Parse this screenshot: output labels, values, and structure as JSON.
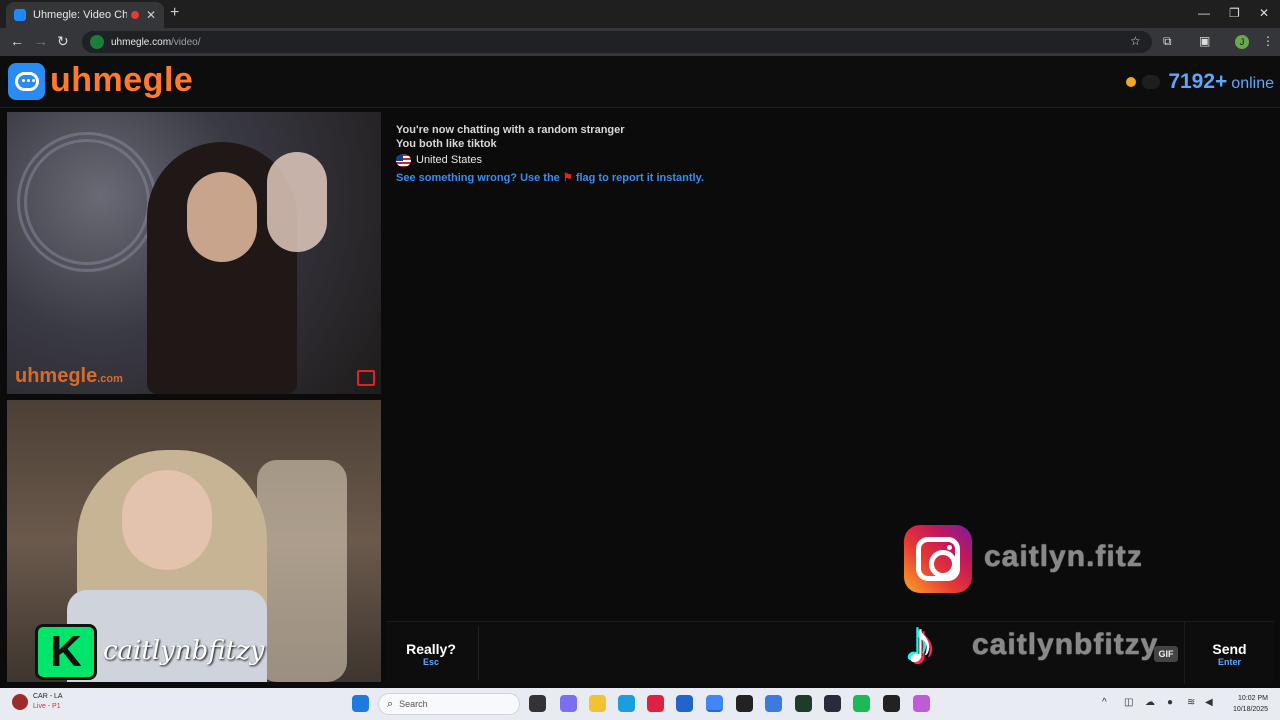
{
  "browser": {
    "tab_title": "Uhmegle: Video Chat | Ran",
    "new_tab": "+",
    "url_host": "uhmegle.com",
    "url_path": "/video/",
    "profile_initial": "J"
  },
  "header": {
    "logo_text": "uhmegle",
    "online_count": "7192+",
    "online_label": "online"
  },
  "stranger_video": {
    "watermark": "uhmegle",
    "watermark_suffix": ".com"
  },
  "self_video": {
    "badge_letter": "K",
    "streamer_name": "caitlynbfitzy"
  },
  "chat": {
    "lines": [
      "You're now chatting with a random stranger",
      "You both like tiktok"
    ],
    "country": "United States",
    "report_before": "See something wrong? Use the",
    "report_flag": "⚑",
    "report_after": "flag to report it instantly."
  },
  "overlays": {
    "instagram_handle": "caitlyn.fitz",
    "tiktok_handle": "caitlynbfitzy",
    "tiktok_glyph": "♪"
  },
  "controls": {
    "skip_label": "Really?",
    "skip_key": "Esc",
    "gif_label": "GIF",
    "send_label": "Send",
    "send_key": "Enter",
    "message_value": ""
  },
  "taskbar": {
    "weather_title": "CAR - LA",
    "weather_status": "Live - P1",
    "search_placeholder": "Search",
    "time": "10:02 PM",
    "date": "10/18/2025"
  },
  "colors": {
    "brand_orange": "#ff7a2a",
    "accent_blue": "#5da8ff",
    "report_blue": "#3b8cf2",
    "flag_red": "#e02424"
  }
}
